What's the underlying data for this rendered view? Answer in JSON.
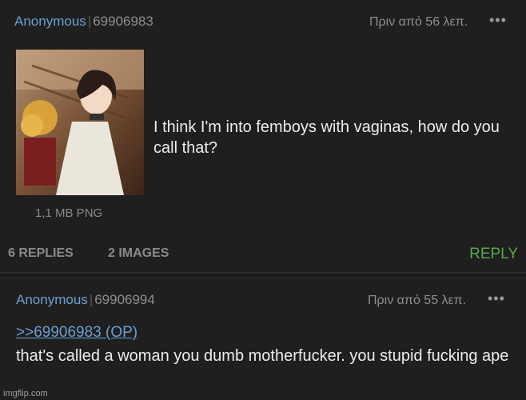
{
  "posts": [
    {
      "name": "Anonymous",
      "sep": "|",
      "id": "69906983",
      "time": "Πριν από 56 λεπ.",
      "menu_icon": "more-dots-icon",
      "file_info": "1,1 MB PNG",
      "text": "I think I'm into femboys with vaginas, how do you call that?"
    },
    {
      "name": "Anonymous",
      "sep": "|",
      "id": "69906994",
      "time": "Πριν από 55 λεπ.",
      "menu_icon": "more-dots-icon",
      "quote": ">>69906983 (OP)",
      "text": "that's called a woman you dumb motherfucker. you stupid fucking ape"
    }
  ],
  "thread": {
    "replies": "6 REPLIES",
    "images": "2 IMAGES",
    "reply_label": "REPLY",
    "reply_color": "#5aa84b"
  },
  "watermark": "imgflip.com"
}
